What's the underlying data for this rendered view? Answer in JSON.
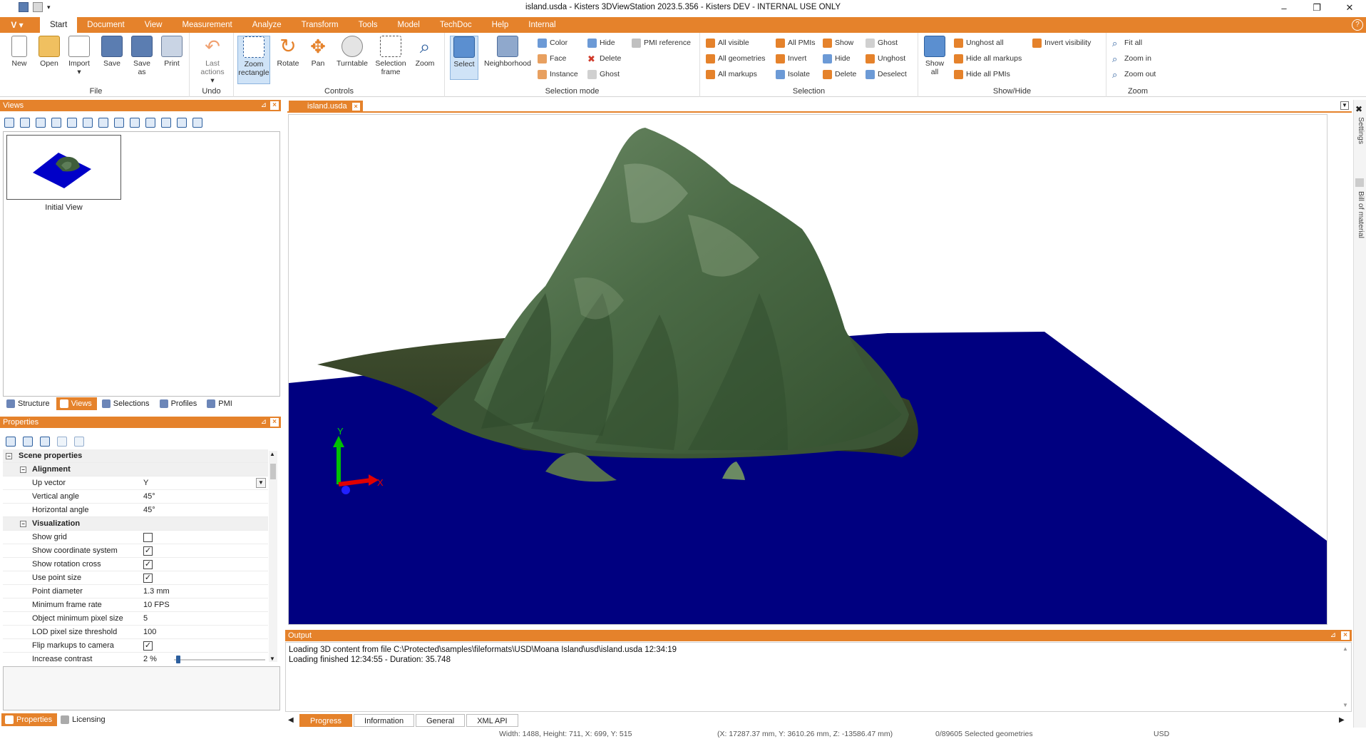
{
  "window": {
    "title": "island.usda - Kisters 3DViewStation 2023.5.356 - Kisters DEV - INTERNAL USE ONLY",
    "minimize": "–",
    "maximize": "❐",
    "close": "✕"
  },
  "menu": {
    "app_button": "V",
    "tabs": [
      "Start",
      "Document",
      "View",
      "Measurement",
      "Analyze",
      "Transform",
      "Tools",
      "Model",
      "TechDoc",
      "Help",
      "Internal"
    ],
    "help": "?"
  },
  "ribbon": {
    "file": {
      "label": "File",
      "new": "New",
      "open": "Open",
      "import": "Import",
      "save": "Save",
      "save_as": "Save as",
      "print": "Print"
    },
    "undo": {
      "label": "Undo",
      "last_actions": "Last actions"
    },
    "controls": {
      "label": "Controls",
      "zoom_rectangle": "Zoom rectangle",
      "rotate": "Rotate",
      "pan": "Pan",
      "turntable": "Turntable",
      "selection_frame": "Selection frame",
      "zoom": "Zoom"
    },
    "selection_mode": {
      "label": "Selection mode",
      "select": "Select",
      "neighborhood": "Neighborhood",
      "color": "Color",
      "face": "Face",
      "instance": "Instance",
      "hide": "Hide",
      "delete": "Delete",
      "ghost": "Ghost",
      "pmi_reference": "PMI reference"
    },
    "selection": {
      "label": "Selection",
      "all_visible": "All visible",
      "all_geometries": "All geometries",
      "all_markups": "All markups",
      "all_pmis": "All PMIs",
      "invert": "Invert",
      "isolate": "Isolate",
      "show": "Show",
      "hide": "Hide",
      "delete": "Delete",
      "ghost": "Ghost",
      "unghost": "Unghost",
      "deselect": "Deselect"
    },
    "show_hide": {
      "label": "Show/Hide",
      "show_all": "Show all",
      "unghost_all": "Unghost all",
      "hide_all_markups": "Hide all markups",
      "hide_all_pmis": "Hide all PMIs",
      "invert_visibility": "Invert visibility"
    },
    "zoom": {
      "label": "Zoom",
      "fit_all": "Fit all",
      "zoom_in": "Zoom in",
      "zoom_out": "Zoom out"
    }
  },
  "views_pane": {
    "title": "Views",
    "pin": "⊿",
    "views": [
      {
        "label": "Initial View"
      }
    ]
  },
  "left_tabs": [
    "Structure",
    "Views",
    "Selections",
    "Profiles",
    "PMI"
  ],
  "properties_pane": {
    "title": "Properties",
    "sections": {
      "scene": "Scene properties",
      "alignment": "Alignment",
      "visualization": "Visualization"
    },
    "rows": {
      "up_vector": {
        "name": "Up vector",
        "value": "Y"
      },
      "vertical_angle": {
        "name": "Vertical angle",
        "value": "45°"
      },
      "horizontal_angle": {
        "name": "Horizontal angle",
        "value": "45°"
      },
      "show_grid": {
        "name": "Show grid",
        "checked": false
      },
      "show_coordinate_system": {
        "name": "Show coordinate system",
        "checked": true
      },
      "show_rotation_cross": {
        "name": "Show rotation cross",
        "checked": true
      },
      "use_point_size": {
        "name": "Use point size",
        "checked": true
      },
      "point_diameter": {
        "name": "Point diameter",
        "value": "1.3 mm"
      },
      "minimum_frame_rate": {
        "name": "Minimum frame rate",
        "value": "10 FPS"
      },
      "object_min_pixel_size": {
        "name": "Object minimum pixel size",
        "value": "5"
      },
      "lod_threshold": {
        "name": "LOD pixel size threshold",
        "value": "100"
      },
      "flip_markups": {
        "name": "Flip markups to camera",
        "checked": true
      },
      "increase_contrast": {
        "name": "Increase contrast",
        "value": "2 %",
        "level": 0.02
      }
    }
  },
  "bottom_left_tabs": [
    "Properties",
    "Licensing"
  ],
  "document": {
    "tab": "island.usda",
    "axes": {
      "y": "Y",
      "x": "X"
    },
    "colors": {
      "water": "#000080",
      "island": "#3d5e3a",
      "accent": "#e5822b"
    }
  },
  "right_sidebar": [
    "Settings",
    "Bill of material"
  ],
  "output": {
    "title": "Output",
    "lines": [
      "Loading 3D content from file C:\\Protected\\samples\\fileformats\\USD\\Moana Island\\usd\\island.usda 12:34:19",
      "Loading finished 12:34:55 - Duration: 35.748"
    ],
    "tabs": [
      "Progress",
      "Information",
      "General",
      "XML API"
    ]
  },
  "status": {
    "viewport_info": "Width: 1488, Height: 711, X: 699, Y: 515",
    "coordinates": "(X: 17287.37 mm, Y: 3610.26 mm, Z: -13586.47 mm)",
    "selected": "0/89605 Selected geometries",
    "units": "USD"
  }
}
